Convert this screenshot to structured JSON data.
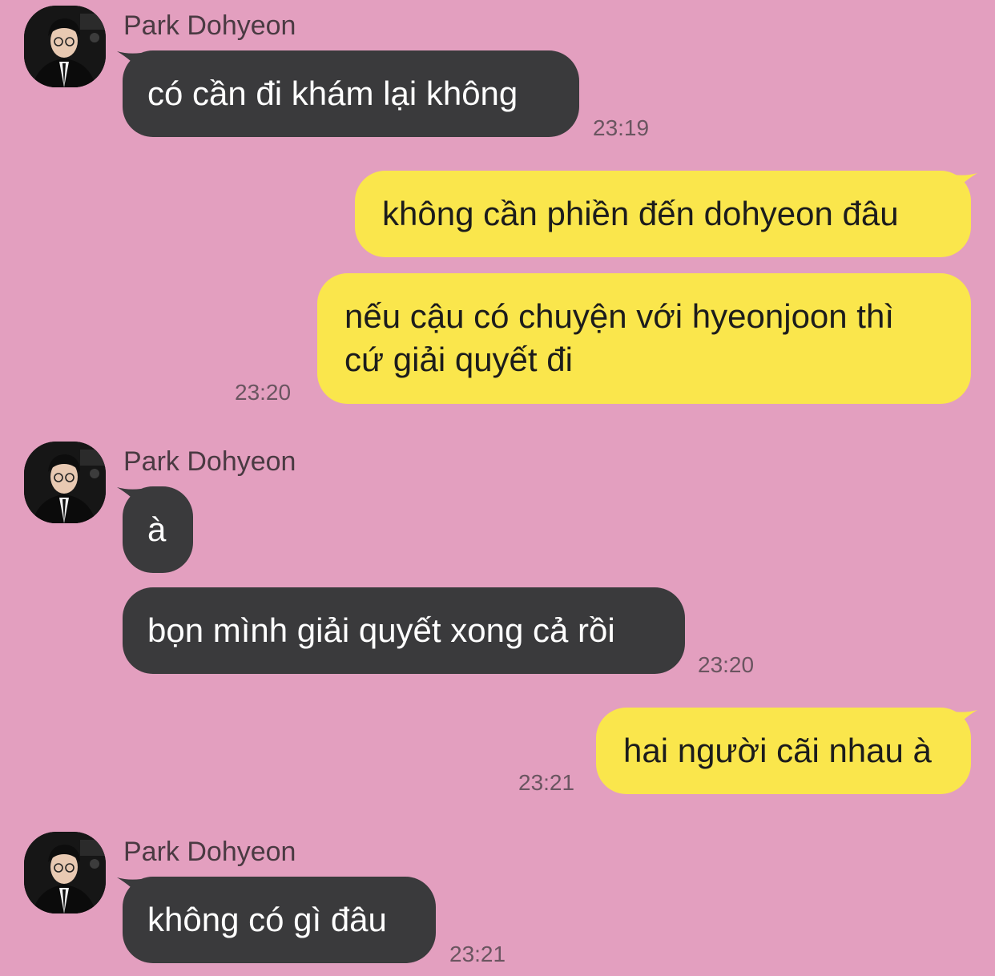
{
  "colors": {
    "background": "#e39fbf",
    "incoming_bubble": "#3a3a3c",
    "outgoing_bubble": "#fae64c",
    "timestamp_text": "#6a5560"
  },
  "messages": [
    {
      "id": "m1",
      "direction": "incoming",
      "sender": "Park Dohyeon",
      "avatar": "profile-photo-avatar",
      "text": "có cần đi khám lại không",
      "time": "23:19"
    },
    {
      "id": "m2",
      "direction": "outgoing",
      "text": "không cần phiền đến dohyeon đâu"
    },
    {
      "id": "m3",
      "direction": "outgoing",
      "text": "nếu cậu có chuyện với hyeonjoon thì cứ giải quyết đi",
      "time": "23:20"
    },
    {
      "id": "m4",
      "direction": "incoming",
      "sender": "Park Dohyeon",
      "avatar": "profile-photo-avatar",
      "text": "à"
    },
    {
      "id": "m5",
      "direction": "incoming",
      "text": "bọn mình giải quyết xong cả rồi",
      "time": "23:20"
    },
    {
      "id": "m6",
      "direction": "outgoing",
      "text": "hai người cãi nhau à",
      "time": "23:21"
    },
    {
      "id": "m7",
      "direction": "incoming",
      "sender": "Park Dohyeon",
      "avatar": "profile-photo-avatar",
      "text": "không có gì đâu",
      "time": "23:21"
    }
  ]
}
